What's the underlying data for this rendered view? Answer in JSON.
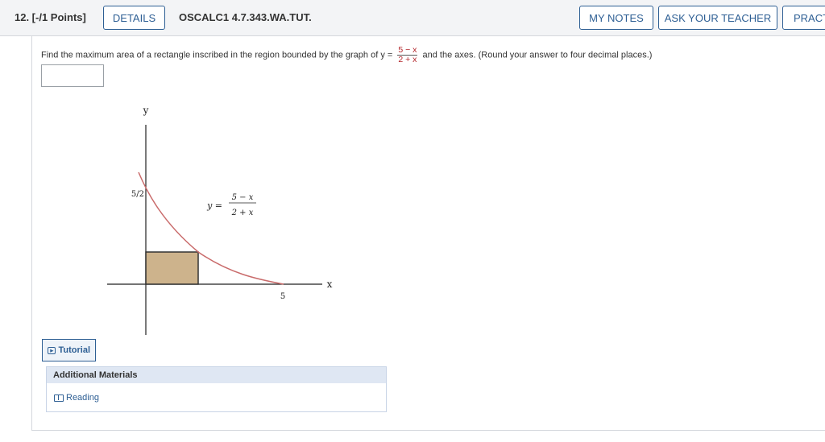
{
  "header": {
    "question_label": "12. [-/1 Points]",
    "details_label": "DETAILS",
    "question_code": "OSCALC1 4.7.343.WA.TUT.",
    "my_notes_label": "MY NOTES",
    "ask_teacher_label": "ASK YOUR TEACHER",
    "practice_label": "PRACT"
  },
  "question": {
    "prompt_before": "Find the maximum area of a rectangle inscribed in the region bounded by the graph of",
    "y_eq": "y =",
    "fraction_numerator": "5 − x",
    "fraction_denominator": "2 + x",
    "prompt_after": "and the axes. (Round your answer to four decimal places.)",
    "answer_value": ""
  },
  "graph": {
    "y_axis_label": "y",
    "x_axis_label": "x",
    "y_intercept_label": "5/2",
    "x_intercept_label": "5",
    "equation_lhs": "y =",
    "equation_numerator": "5 − x",
    "equation_denominator": "2 + x",
    "curve_color": "#c96b6b",
    "rect_fill": "#cdb38c"
  },
  "tutorial": {
    "label": "Tutorial",
    "icon": "tutorial-icon"
  },
  "additional_materials": {
    "heading": "Additional Materials",
    "items": [
      {
        "label": "Reading",
        "icon": "book-icon"
      }
    ]
  }
}
